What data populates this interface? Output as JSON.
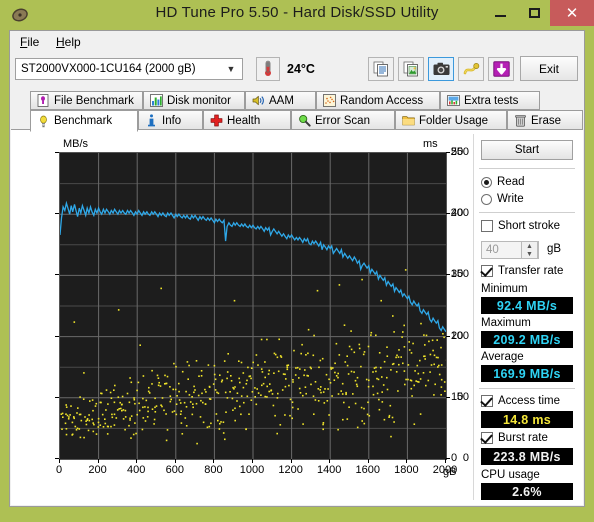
{
  "window": {
    "title": "HD Tune Pro 5.50 - Hard Disk/SSD Utility",
    "titlebar_color": "#aec054",
    "close_color": "#c75b5b",
    "icon": "hard-disk-icon",
    "minimize_label": "–",
    "maximize_label": "□",
    "close_label": "✕"
  },
  "menu": {
    "items": [
      {
        "label": "File",
        "mnemonic": "F"
      },
      {
        "label": "Help",
        "mnemonic": "H"
      }
    ]
  },
  "toolbar": {
    "drive": {
      "value": "ST2000VX000-1CU164 (2000 gB)",
      "arrow": "▼"
    },
    "temperature": {
      "icon": "thermometer-icon",
      "value": "24°C"
    },
    "buttons": [
      {
        "name": "copy-text-button",
        "icon": "copy-text-icon",
        "selected": false
      },
      {
        "name": "copy-image-button",
        "icon": "copy-image-icon",
        "selected": false
      },
      {
        "name": "screenshot-button",
        "icon": "camera-icon",
        "selected": true
      },
      {
        "name": "settings-button",
        "icon": "cable-icon",
        "selected": false
      },
      {
        "name": "save-button",
        "icon": "download-arrow-icon",
        "selected": false
      }
    ],
    "exit_label": "Exit"
  },
  "tabs": {
    "row1": [
      {
        "label": "File Benchmark",
        "icon": "file-benchmark-icon"
      },
      {
        "label": "Disk monitor",
        "icon": "bar-chart-icon"
      },
      {
        "label": "AAM",
        "icon": "speaker-icon"
      },
      {
        "label": "Random Access",
        "icon": "scatter-icon"
      },
      {
        "label": "Extra tests",
        "icon": "extra-tests-icon"
      }
    ],
    "row2": [
      {
        "label": "Benchmark",
        "icon": "lightbulb-icon",
        "active": true
      },
      {
        "label": "Info",
        "icon": "info-icon",
        "active": false
      },
      {
        "label": "Health",
        "icon": "red-cross-icon",
        "active": false
      },
      {
        "label": "Error Scan",
        "icon": "magnifier-icon",
        "active": false
      },
      {
        "label": "Folder Usage",
        "icon": "folder-icon",
        "active": false
      },
      {
        "label": "Erase",
        "icon": "trash-icon",
        "active": false
      }
    ]
  },
  "panel": {
    "start_label": "Start",
    "mode": {
      "read_label": "Read",
      "write_label": "Write",
      "selected": "Read"
    },
    "short_stroke": {
      "label": "Short stroke",
      "checked": false,
      "value": "40",
      "unit": "gB",
      "spin_up": "▲",
      "spin_down": "▼"
    },
    "transfer_rate": {
      "label": "Transfer rate",
      "checked": true,
      "minimum_label": "Minimum",
      "minimum_value": "92.4 MB/s",
      "maximum_label": "Maximum",
      "maximum_value": "209.2 MB/s",
      "average_label": "Average",
      "average_value": "169.9 MB/s"
    },
    "access_time": {
      "label": "Access time",
      "checked": true,
      "value": "14.8 ms"
    },
    "burst_rate": {
      "label": "Burst rate",
      "checked": true,
      "value": "223.8 MB/s"
    },
    "cpu_usage": {
      "label": "CPU usage",
      "value": "2.6%"
    }
  },
  "chart_data": {
    "type": "line",
    "title": "",
    "xlabel": "gB",
    "ylabel": "MB/s",
    "y2label": "ms",
    "xlim": [
      0,
      2000
    ],
    "ylim": [
      0,
      250
    ],
    "y2lim": [
      0,
      50
    ],
    "grid": true,
    "legend": "none",
    "xticks": [
      0,
      200,
      400,
      600,
      800,
      1000,
      1200,
      1400,
      1600,
      1800,
      2000
    ],
    "xtick_labels": [
      "0",
      "200",
      "400",
      "600",
      "800",
      "1000",
      "1200",
      "1400",
      "1600",
      "1800",
      "2000"
    ],
    "yticks": [
      0,
      50,
      100,
      150,
      200,
      250
    ],
    "ytick_labels": [
      "0",
      "50",
      "100",
      "150",
      "200",
      "250"
    ],
    "y2ticks": [
      0,
      10,
      20,
      30,
      40,
      50
    ],
    "y2tick_labels": [
      "0",
      "10",
      "20",
      "30",
      "40",
      "50"
    ],
    "plot_bg": "#1d1d1d",
    "grid_color": "#6a6a6a",
    "series": [
      {
        "name": "Transfer rate",
        "axis": "left",
        "color": "#2fa8e8",
        "unit": "MB/s",
        "x": [
          0,
          8,
          16,
          25,
          33,
          41,
          50,
          58,
          66,
          75,
          83,
          91,
          100,
          108,
          116,
          125,
          133,
          141,
          150,
          158,
          166,
          175,
          183,
          191,
          200,
          208,
          216,
          225,
          233,
          241,
          250,
          258,
          266,
          275,
          283,
          291,
          300,
          308,
          316,
          325,
          333,
          341,
          350,
          358,
          366,
          375,
          383,
          391,
          400,
          408,
          416,
          425,
          433,
          441,
          450,
          458,
          466,
          475,
          483,
          491,
          500,
          508,
          516,
          525,
          533,
          541,
          550,
          558,
          566,
          575,
          583,
          591,
          600,
          608,
          616,
          625,
          633,
          641,
          650,
          658,
          666,
          675,
          683,
          691,
          700,
          708,
          716,
          725,
          733,
          741,
          750,
          758,
          766,
          775,
          783,
          791,
          800,
          808,
          816,
          825,
          833,
          841,
          850,
          858,
          866,
          875,
          883,
          891,
          900,
          908,
          916,
          925,
          933,
          941,
          950,
          958,
          966,
          975,
          983,
          991,
          1000,
          1008,
          1016,
          1025,
          1033,
          1041,
          1050,
          1058,
          1066,
          1075,
          1083,
          1091,
          1100,
          1108,
          1116,
          1125,
          1133,
          1141,
          1150,
          1158,
          1166,
          1175,
          1183,
          1191,
          1200,
          1208,
          1216,
          1225,
          1233,
          1241,
          1250,
          1258,
          1266,
          1275,
          1283,
          1291,
          1300,
          1308,
          1316,
          1325,
          1333,
          1341,
          1350,
          1358,
          1366,
          1375,
          1383,
          1391,
          1400,
          1408,
          1416,
          1425,
          1433,
          1441,
          1450,
          1458,
          1466,
          1475,
          1483,
          1491,
          1500,
          1508,
          1516,
          1525,
          1533,
          1541,
          1550,
          1558,
          1566,
          1575,
          1583,
          1591,
          1600,
          1608,
          1616,
          1625,
          1633,
          1641,
          1650,
          1658,
          1666,
          1675,
          1683,
          1691,
          1700,
          1708,
          1716,
          1725,
          1733,
          1741,
          1750,
          1758,
          1766,
          1775,
          1783,
          1791,
          1800,
          1808,
          1816,
          1825,
          1833,
          1841,
          1850,
          1858,
          1866,
          1875,
          1883,
          1891,
          1900,
          1908,
          1916,
          1925,
          1933,
          1941,
          1950,
          1958,
          1966,
          1975,
          1983,
          1991,
          2000
        ],
        "y": [
          183,
          197,
          206,
          203,
          209,
          205,
          200,
          207,
          202,
          208,
          203,
          198,
          205,
          201,
          207,
          203,
          199,
          205,
          201,
          206,
          202,
          199,
          204,
          201,
          205,
          202,
          200,
          204,
          201,
          204,
          202,
          200,
          203,
          201,
          204,
          202,
          200,
          203,
          201,
          203,
          201,
          200,
          203,
          201,
          203,
          201,
          199,
          202,
          200,
          203,
          201,
          199,
          202,
          200,
          202,
          200,
          199,
          202,
          200,
          202,
          200,
          198,
          201,
          199,
          201,
          199,
          198,
          201,
          199,
          201,
          199,
          197,
          200,
          198,
          200,
          198,
          197,
          199,
          197,
          199,
          197,
          196,
          199,
          197,
          199,
          197,
          195,
          198,
          196,
          198,
          196,
          195,
          197,
          195,
          197,
          195,
          193,
          196,
          194,
          196,
          194,
          193,
          195,
          178,
          190,
          193,
          191,
          190,
          193,
          191,
          193,
          191,
          190,
          192,
          190,
          192,
          190,
          189,
          191,
          189,
          191,
          189,
          188,
          190,
          188,
          190,
          188,
          186,
          189,
          187,
          189,
          183,
          186,
          188,
          186,
          184,
          186,
          184,
          182,
          184,
          182,
          180,
          183,
          181,
          183,
          181,
          179,
          181,
          179,
          181,
          179,
          177,
          180,
          178,
          180,
          176,
          175,
          178,
          176,
          178,
          176,
          174,
          177,
          171,
          175,
          173,
          171,
          174,
          172,
          174,
          168,
          170,
          172,
          170,
          168,
          171,
          165,
          168,
          166,
          164,
          166,
          164,
          162,
          165,
          163,
          160,
          162,
          155,
          158,
          160,
          158,
          156,
          158,
          152,
          155,
          153,
          151,
          153,
          147,
          150,
          148,
          146,
          148,
          142,
          145,
          143,
          141,
          143,
          137,
          140,
          138,
          136,
          138,
          133,
          135,
          133,
          131,
          133,
          128,
          126,
          129,
          127,
          125,
          127,
          121,
          119,
          122,
          120,
          118,
          120,
          114,
          112,
          115,
          113,
          111,
          113,
          107,
          105,
          108,
          106,
          104,
          106,
          100,
          98,
          101,
          99,
          97,
          99,
          94,
          92,
          95,
          93,
          92
        ]
      },
      {
        "name": "Access time",
        "axis": "right",
        "color": "#f1e52a",
        "unit": "ms",
        "marker": "dot",
        "average": 14.8
      }
    ]
  }
}
